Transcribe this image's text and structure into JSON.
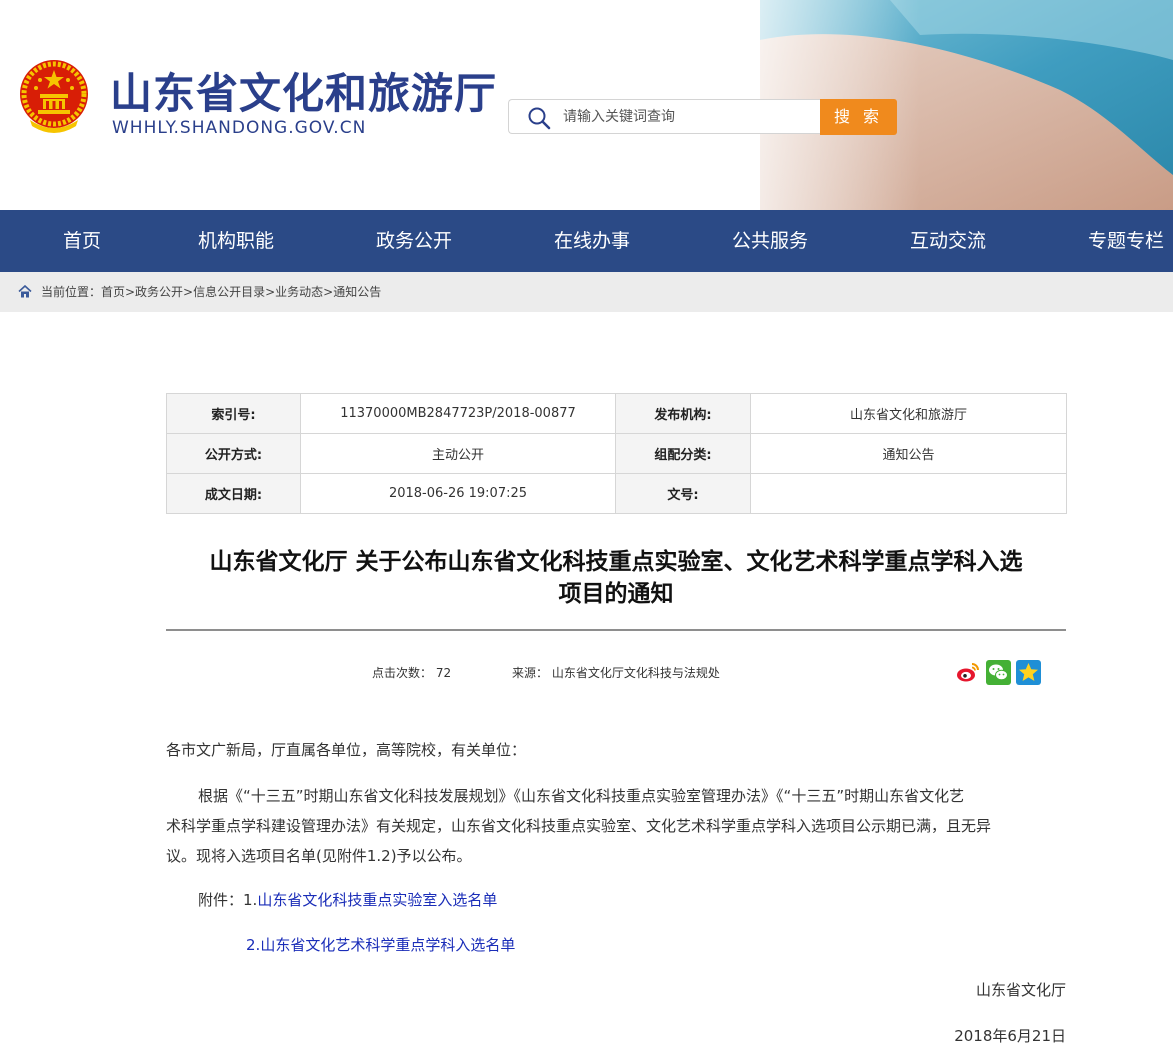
{
  "header": {
    "title": "山东省文化和旅游厅",
    "domain": "WHHLY.SHANDONG.GOV.CN",
    "search_placeholder": "请输入关键词查询",
    "search_button": "搜 索"
  },
  "nav": {
    "items": [
      "首页",
      "机构职能",
      "政务公开",
      "在线办事",
      "公共服务",
      "互动交流",
      "专题专栏"
    ]
  },
  "breadcrumb": {
    "text": "当前位置：首页>政务公开>信息公开目录>业务动态>通知公告"
  },
  "meta": {
    "index_label": "索引号:",
    "index_value": "11370000MB2847723P/2018-00877",
    "publisher_label": "发布机构:",
    "publisher_value": "山东省文化和旅游厅",
    "mode_label": "公开方式:",
    "mode_value": "主动公开",
    "category_label": "组配分类:",
    "category_value": "通知公告",
    "date_label": "成文日期:",
    "date_value": "2018-06-26 19:07:25",
    "docno_label": "文号:",
    "docno_value": ""
  },
  "article": {
    "title_line1": "山东省文化厅 关于公布山东省文化科技重点实验室、文化艺术科学重点学科入选",
    "title_line2": "项目的通知",
    "clicks": "点击次数： 72",
    "source": "来源： 山东省文化厅文化科技与法规处",
    "salutation": "各市文广新局，厅直属各单位，高等院校，有关单位：",
    "body_line1": "根据《“十三五”时期山东省文化科技发展规划》《山东省文化科技重点实验室管理办法》《“十三五”时期山东省文化艺",
    "body_line2": "术科学重点学科建设管理办法》有关规定，山东省文化科技重点实验室、文化艺术科学重点学科入选项目公示期已满，且无异",
    "body_line3": "议。现将入选项目名单(见附件1.2)予以公布。",
    "attachment_prefix": "附件：",
    "attachment1_num": "1.",
    "attachment1": "山东省文化科技重点实验室入选名单",
    "attachment2_num": "2.",
    "attachment2": "山东省文化艺术科学重点学科入选名单",
    "signature": "山东省文化厅",
    "date": "2018年6月21日"
  },
  "colors": {
    "nav_bg": "#2b4a86",
    "title_blue": "#2a3f8b",
    "search_button": "#f08a1d",
    "link": "#1a2db8"
  },
  "icons": [
    "national-emblem",
    "search-icon",
    "home-icon",
    "weibo-icon",
    "wechat-icon",
    "favorite-star-icon"
  ]
}
